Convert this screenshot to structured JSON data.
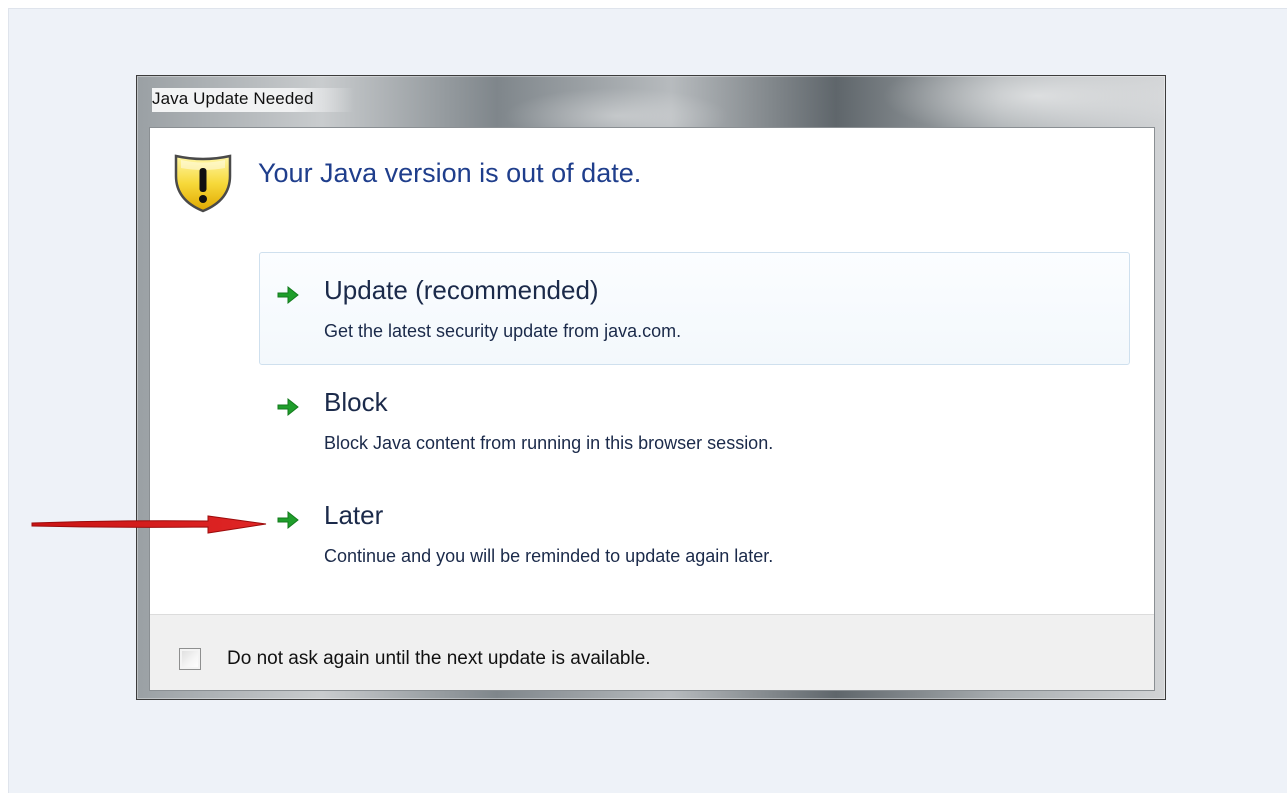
{
  "window": {
    "title": "Java Update Needed"
  },
  "header": {
    "message": "Your Java version is out of date.",
    "icon": "warning-shield-icon"
  },
  "options": [
    {
      "title": "Update (recommended)",
      "description": "Get the latest security update from java.com.",
      "icon": "green-arrow-icon",
      "highlighted": true
    },
    {
      "title": "Block",
      "description": "Block Java content from running in this browser session.",
      "icon": "green-arrow-icon",
      "highlighted": false
    },
    {
      "title": "Later",
      "description": "Continue and you will be reminded to update again later.",
      "icon": "green-arrow-icon",
      "highlighted": false
    }
  ],
  "footer": {
    "checkbox_label": "Do not ask again until the next update is available.",
    "checked": false
  },
  "annotation": {
    "icon": "red-pointer-arrow-icon",
    "color": "#d41e1e"
  },
  "colors": {
    "header_text": "#1f3e8c",
    "option_text": "#1b2a4a",
    "arrow_green": "#1f9e2b",
    "page_background": "#eef2f8"
  }
}
